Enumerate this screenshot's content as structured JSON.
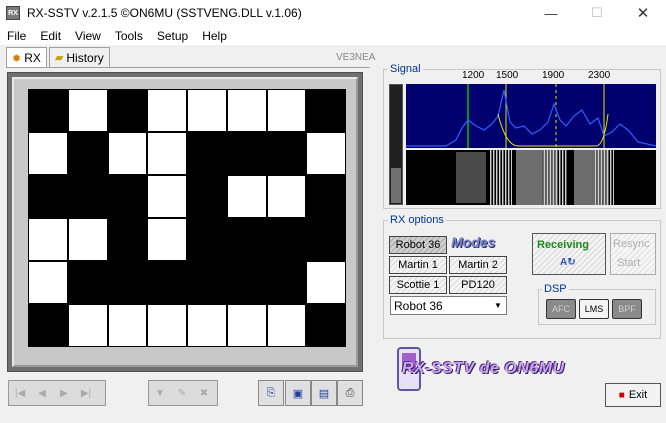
{
  "window": {
    "title": "RX-SSTV v.2.1.5 ©ON6MU (SSTVENG.DLL v.1.06)",
    "minimize": "—",
    "maximize": "☐",
    "close": "✕"
  },
  "menu": [
    "File",
    "Edit",
    "View",
    "Tools",
    "Setup",
    "Help"
  ],
  "tabs": [
    {
      "label": "RX",
      "icon": "gear-icon"
    },
    {
      "label": "History",
      "icon": "folder-icon"
    }
  ],
  "callsign": "VE3NEA",
  "signal": {
    "label": "Signal",
    "freq_labels": [
      "1200",
      "1500",
      "1900",
      "2300"
    ],
    "colors": {
      "background": "#00006e",
      "trace": "#2f5fff",
      "filter": "#e6e600",
      "sync_marker": "#00c000"
    }
  },
  "rx_options": {
    "label": "RX options",
    "modes_logo": "Modes",
    "mode_buttons": [
      "Robot 36",
      "Martin 1",
      "Martin 2",
      "Scottie 1",
      "PD120"
    ],
    "selected_mode": "Robot 36",
    "status": {
      "receiving": "Receiving",
      "auto_icon": "A↻",
      "resync_1": "Resync",
      "resync_2": "Start"
    }
  },
  "dsp": {
    "label": "DSP",
    "buttons": [
      {
        "label": "AFC",
        "on": false
      },
      {
        "label": "LMS",
        "on": true
      },
      {
        "label": "BPF",
        "on": false
      }
    ]
  },
  "banner": "RX-SSTV de ON6MU",
  "exit_label": "Exit",
  "image_grid": {
    "cols": 8,
    "rows": 6,
    "pattern": [
      [
        0,
        1,
        0,
        1,
        1,
        1,
        1,
        0
      ],
      [
        1,
        0,
        1,
        1,
        0,
        0,
        0,
        1
      ],
      [
        0,
        0,
        0,
        1,
        0,
        1,
        1,
        0
      ],
      [
        1,
        1,
        0,
        1,
        0,
        0,
        0,
        0
      ],
      [
        1,
        0,
        0,
        0,
        0,
        0,
        0,
        1
      ],
      [
        0,
        1,
        1,
        1,
        1,
        1,
        1,
        0
      ]
    ]
  }
}
